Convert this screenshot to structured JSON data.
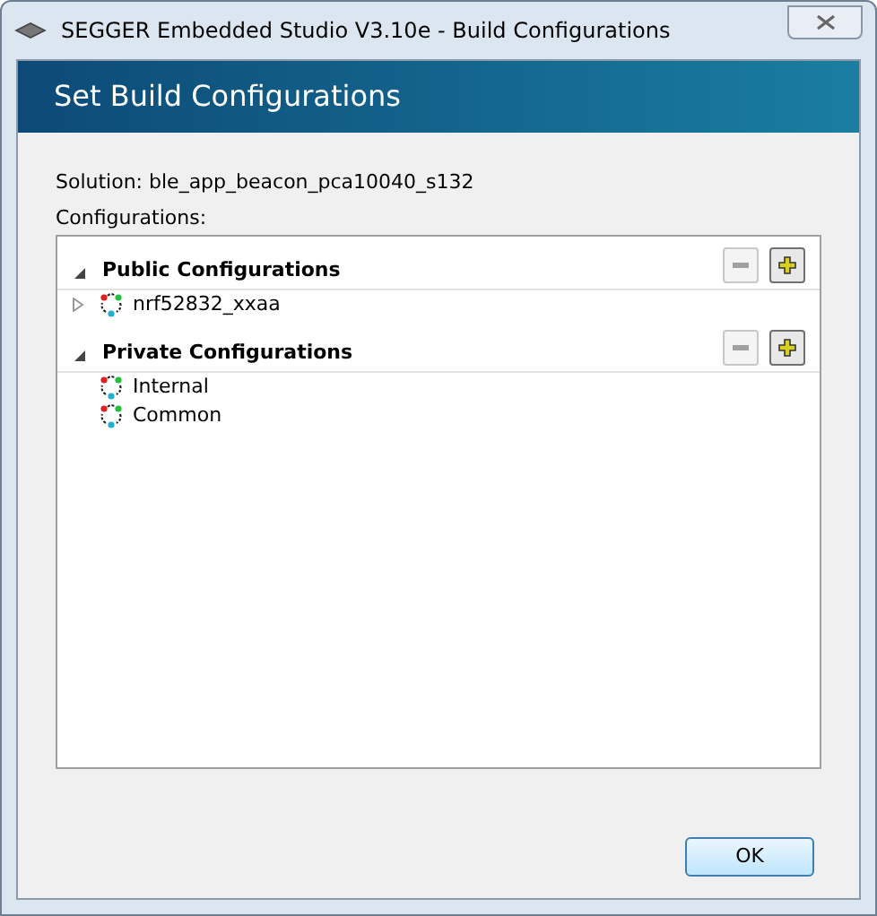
{
  "window": {
    "title": "SEGGER Embedded Studio V3.10e - Build Configurations"
  },
  "header": {
    "title": "Set Build Configurations"
  },
  "solution": "Solution: ble_app_beacon_pca10040_s132",
  "configurations_label": "Configurations:",
  "groups": [
    {
      "label": "Public Configurations",
      "expanded": true,
      "remove_disabled": true,
      "add_disabled": false,
      "children": [
        {
          "label": "nrf52832_xxaa",
          "expandable": true
        }
      ]
    },
    {
      "label": "Private Configurations",
      "expanded": true,
      "remove_disabled": true,
      "add_disabled": false,
      "children": [
        {
          "label": "Internal",
          "expandable": false
        },
        {
          "label": "Common",
          "expandable": false
        }
      ]
    }
  ],
  "buttons": [
    {
      "label": "OK"
    }
  ]
}
